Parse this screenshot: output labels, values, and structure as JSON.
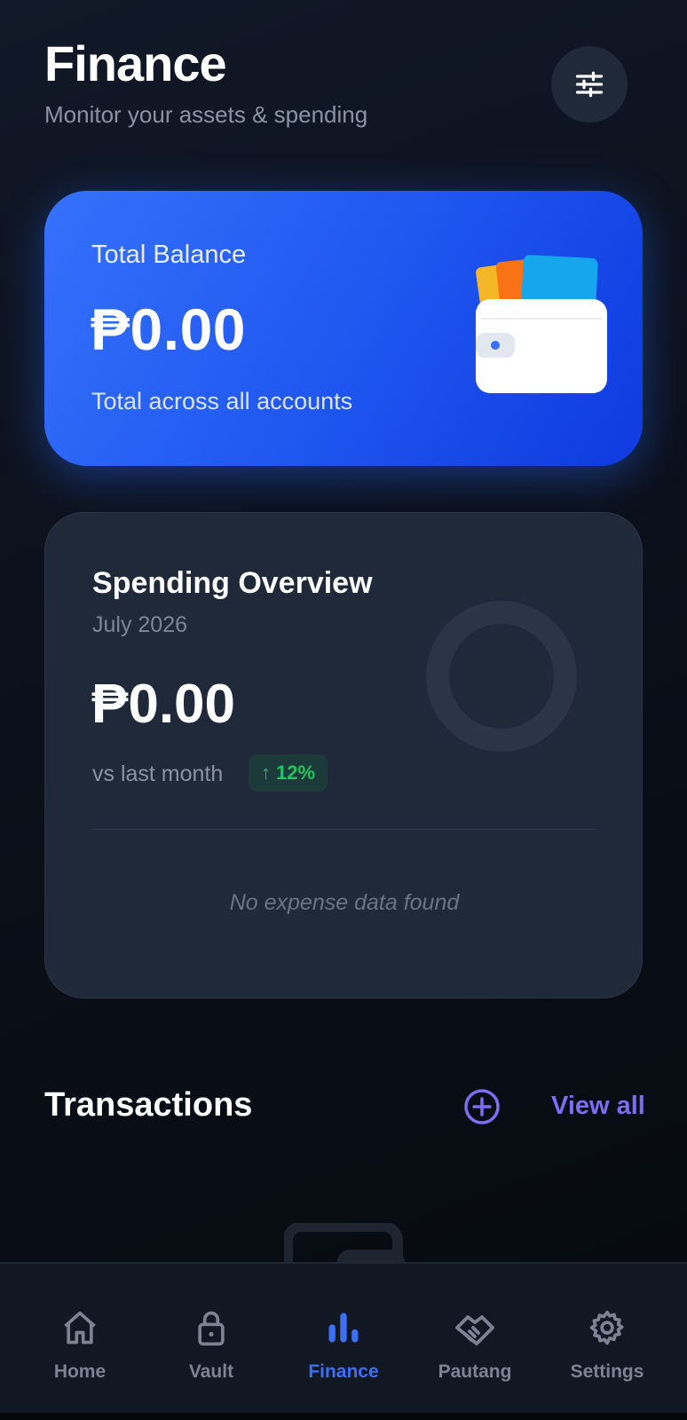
{
  "header": {
    "title": "Finance",
    "subtitle": "Monitor your assets & spending",
    "filter_icon": "sliders-icon"
  },
  "balance": {
    "label": "Total Balance",
    "amount": "₱0.00",
    "caption": "Total across all accounts",
    "illustration": "wallet-cards-icon"
  },
  "spending": {
    "title": "Spending Overview",
    "month": "July 2026",
    "amount": "₱0.00",
    "compare_label": "vs last month",
    "change_arrow": "↑",
    "change_value": "12%",
    "empty_text": "No expense data found",
    "donut_percent": 0
  },
  "transactions": {
    "title": "Transactions",
    "add_icon": "plus-circle-icon",
    "view_all": "View all"
  },
  "nav": {
    "items": [
      {
        "label": "Home",
        "icon": "home-icon",
        "active": false
      },
      {
        "label": "Vault",
        "icon": "lock-icon",
        "active": false
      },
      {
        "label": "Finance",
        "icon": "bar-chart-icon",
        "active": true
      },
      {
        "label": "Pautang",
        "icon": "handshake-icon",
        "active": false
      },
      {
        "label": "Settings",
        "icon": "gear-icon",
        "active": false
      }
    ]
  },
  "colors": {
    "accent": "#3b6ff5",
    "link": "#7c6df5",
    "positive": "#22c55e",
    "card_bg": "#1f293a",
    "balance_gradient_start": "#3571fb",
    "balance_gradient_end": "#0f3ae0"
  }
}
